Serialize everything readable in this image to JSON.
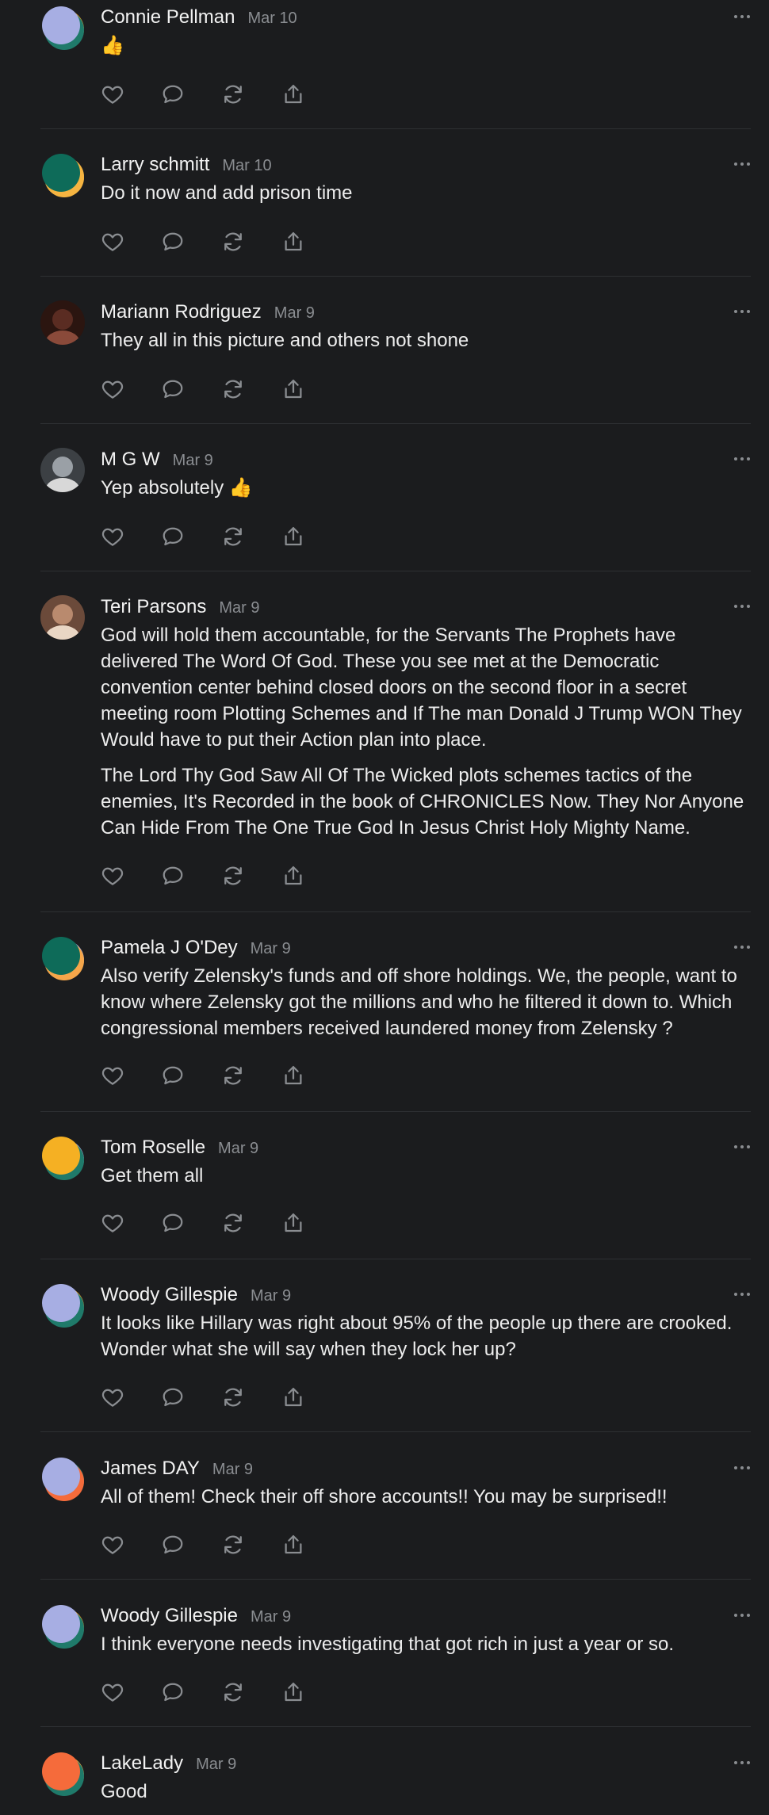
{
  "comments": [
    {
      "name": "Connie Pellman",
      "date": "Mar 10",
      "paragraphs": [
        "👍"
      ],
      "avatar": {
        "kind": "circle",
        "main": "#a7aee3",
        "accent": "#1f7a6a",
        "accent2": "#f5a623"
      }
    },
    {
      "name": "Larry schmitt",
      "date": "Mar 10",
      "paragraphs": [
        "Do it now and add prison time"
      ],
      "avatar": {
        "kind": "circle",
        "main": "#0e6b59",
        "accent": "#f5b441",
        "accent2": "#f5b441"
      }
    },
    {
      "name": "Mariann Rodriguez",
      "date": "Mar 9",
      "paragraphs": [
        "They all in this picture and others not shone"
      ],
      "avatar": {
        "kind": "photo",
        "main": "#5a2c22",
        "accent": "#2b1510",
        "accent2": "#8a4a3a"
      }
    },
    {
      "name": "M G W",
      "date": "Mar 9",
      "paragraphs": [
        "Yep absolutely 👍"
      ],
      "avatar": {
        "kind": "photo",
        "main": "#9aa0a6",
        "accent": "#3c4044",
        "accent2": "#d8d8d8"
      }
    },
    {
      "name": "Teri Parsons",
      "date": "Mar 9",
      "paragraphs": [
        "God will hold them accountable, for the Servants The Prophets have delivered The Word Of God. These you see met at the Democratic convention center behind closed doors on the second floor in a secret meeting room Plotting Schemes and If The man Donald J Trump WON They Would have to put their Action plan into place.",
        "The Lord Thy God Saw All Of The Wicked plots schemes tactics of the enemies, It's Recorded in the book of CHRONICLES Now. They Nor Anyone Can Hide From The One True God In Jesus Christ Holy Mighty Name."
      ],
      "avatar": {
        "kind": "photo",
        "main": "#b98a6e",
        "accent": "#6b4a3a",
        "accent2": "#e9d6c4"
      }
    },
    {
      "name": "Pamela J O'Dey",
      "date": "Mar 9",
      "paragraphs": [
        "Also verify Zelensky's funds and off shore holdings. We, the people, want to know where Zelensky got the millions and who he filtered it down to. Which congressional members received laundered money from Zelensky ?"
      ],
      "avatar": {
        "kind": "circle",
        "main": "#0e6b59",
        "accent": "#f5a64a",
        "accent2": "#a7aee3"
      }
    },
    {
      "name": "Tom Roselle",
      "date": "Mar 9",
      "paragraphs": [
        "Get them all"
      ],
      "avatar": {
        "kind": "circle",
        "main": "#f5b023",
        "accent": "#1f7a6a",
        "accent2": "#a7aee3"
      }
    },
    {
      "name": "Woody Gillespie",
      "date": "Mar 9",
      "paragraphs": [
        "It looks like Hillary was right about 95% of the people up there are crooked. Wonder what she will say when they lock her up?"
      ],
      "avatar": {
        "kind": "circle",
        "main": "#a7aee3",
        "accent": "#1f7a6a",
        "accent2": "#f5a623"
      }
    },
    {
      "name": "James DAY",
      "date": "Mar 9",
      "paragraphs": [
        "All of them! Check their off shore accounts!! You may be surprised!!"
      ],
      "avatar": {
        "kind": "circle",
        "main": "#a7aee3",
        "accent": "#f56b3b",
        "accent2": "#1f7a6a"
      }
    },
    {
      "name": "Woody Gillespie",
      "date": "Mar 9",
      "paragraphs": [
        "I think everyone needs investigating that got rich in just a year or so."
      ],
      "avatar": {
        "kind": "circle",
        "main": "#a7aee3",
        "accent": "#1f7a6a",
        "accent2": "#f5a623"
      }
    },
    {
      "name": "LakeLady",
      "date": "Mar 9",
      "paragraphs": [
        "Good"
      ],
      "avatar": {
        "kind": "circle",
        "main": "#f56b3b",
        "accent": "#1f7a6a",
        "accent2": "#f5b441"
      }
    }
  ],
  "icons": {
    "like": "heart-icon",
    "reply": "comment-bubble-icon",
    "repost": "repost-icon",
    "share": "share-icon",
    "more": "more-dots-icon"
  },
  "colors": {
    "background": "#1b1c1e",
    "divider": "#2e3033",
    "icon": "#8a8d91",
    "muted_text": "#8a8d91"
  }
}
